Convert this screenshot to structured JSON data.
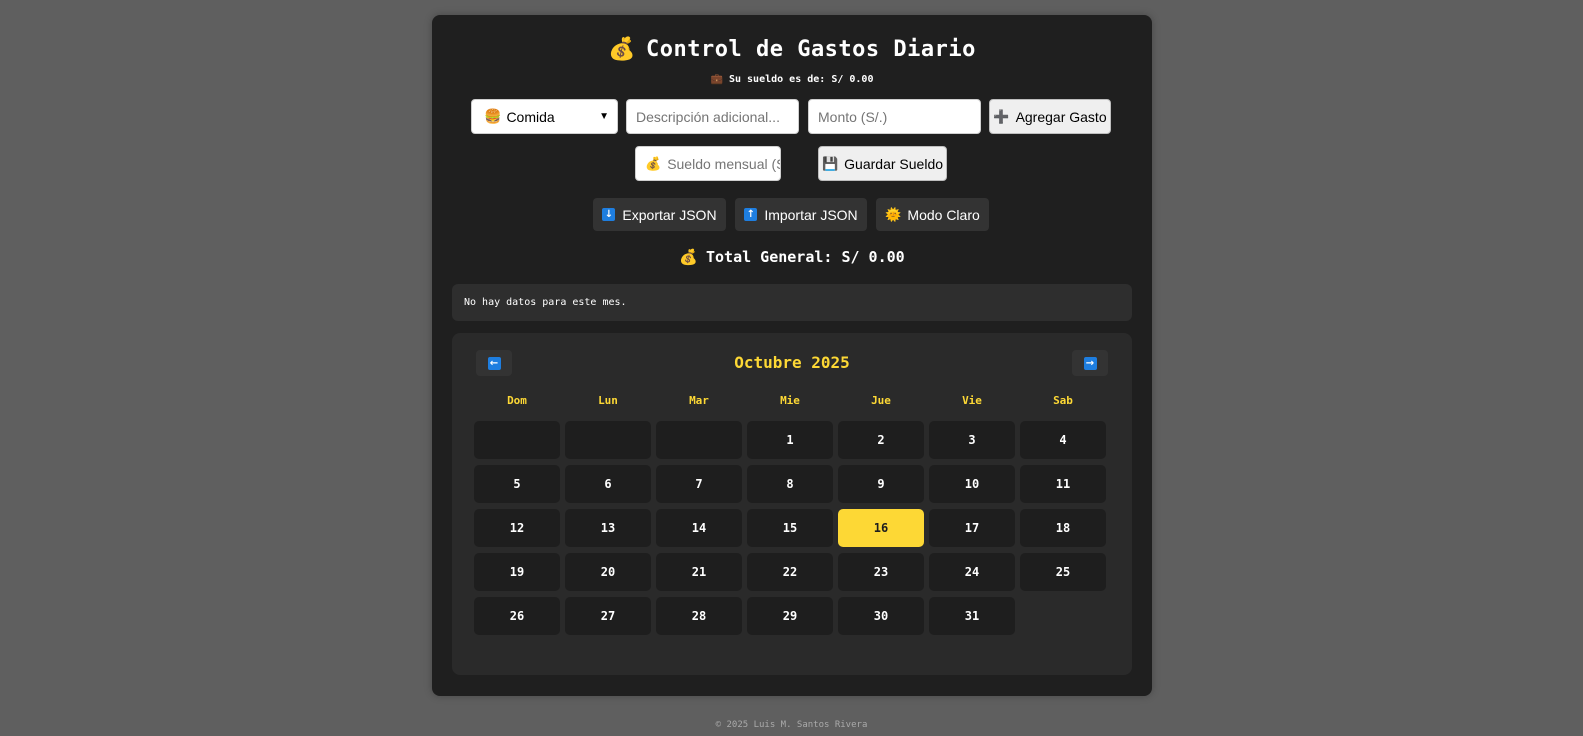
{
  "app": {
    "title": "Control de Gastos Diario",
    "title_icon": "money-bag",
    "salary_label": "Su sueldo es de: S/ 0.00",
    "salary_icon": "briefcase"
  },
  "form": {
    "category_selected": "Comida",
    "category_icon": "hamburger",
    "description_placeholder": "Descripción adicional...",
    "amount_placeholder": "Monto (S/.)",
    "add_button": "Agregar Gasto",
    "add_icon": "plus",
    "salary_placeholder": "Sueldo mensual (S/.)",
    "salary_input_icon": "money-bag",
    "save_salary_button": "Guardar Sueldo",
    "save_icon": "floppy-disk"
  },
  "actions": {
    "export": "Exportar JSON",
    "export_icon": "down-arrow-box",
    "import": "Importar JSON",
    "import_icon": "up-arrow-box",
    "mode": "Modo Claro",
    "mode_icon": "sun"
  },
  "summary": {
    "total": "Total General: S/ 0.00",
    "total_icon": "money-bag",
    "empty_message": "No hay datos para este mes."
  },
  "calendar": {
    "month_label": "Octubre 2025",
    "prev_icon": "left-arrow-box",
    "next_icon": "right-arrow-box",
    "weekdays": [
      "Dom",
      "Lun",
      "Mar",
      "Mie",
      "Jue",
      "Vie",
      "Sab"
    ],
    "leading_blanks": 3,
    "days_in_month": 31,
    "today": 16
  },
  "footer": "© 2025 Luis M. Santos Rivera",
  "colors": {
    "page_bg": "#5f5f5f",
    "panel_bg": "#1f1f1f",
    "accent": "#fdd835",
    "day_bg": "#1e1e1e",
    "nav_blue": "#1e7ee0"
  }
}
